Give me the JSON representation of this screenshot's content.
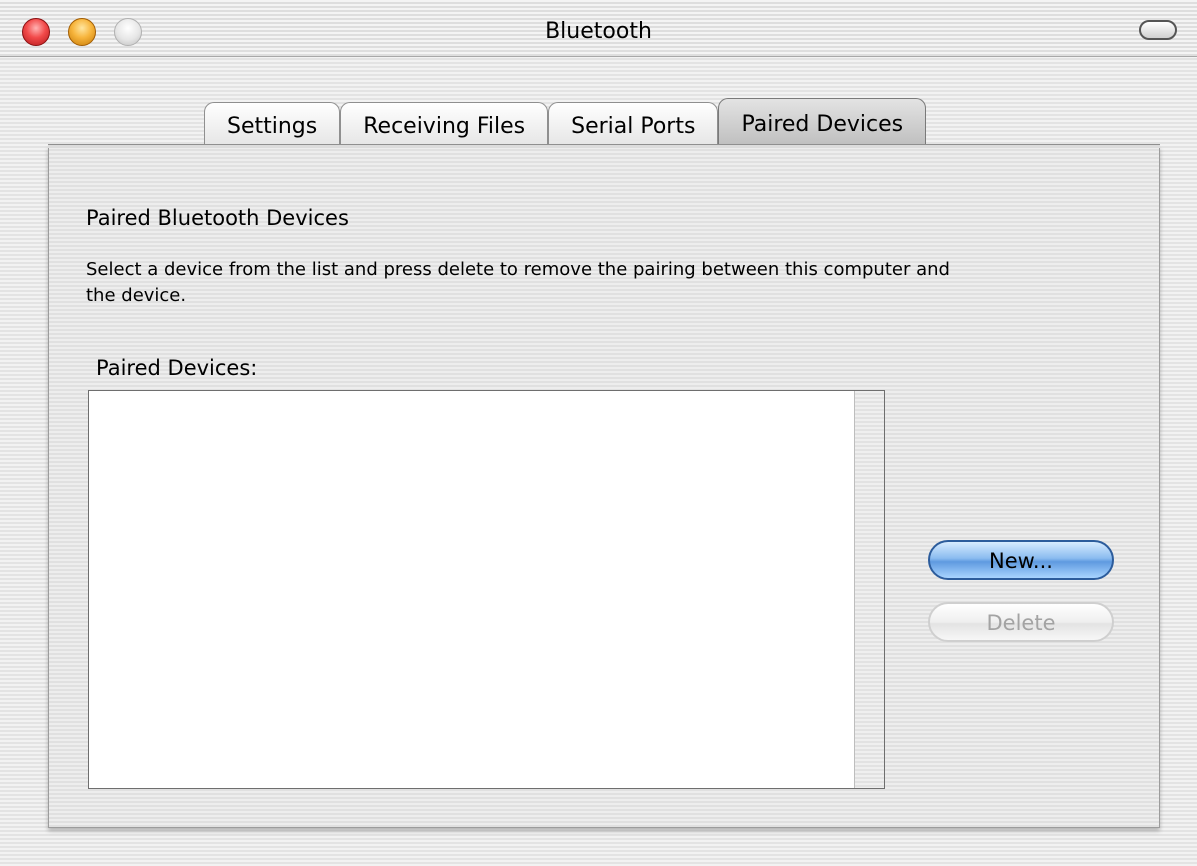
{
  "window": {
    "title": "Bluetooth"
  },
  "tabs": [
    {
      "label": "Settings",
      "selected": false
    },
    {
      "label": "Receiving Files",
      "selected": false
    },
    {
      "label": "Serial Ports",
      "selected": false
    },
    {
      "label": "Paired Devices",
      "selected": true
    }
  ],
  "panel": {
    "section_title": "Paired Bluetooth Devices",
    "description": "Select a device from the list and press delete to remove the pairing between this computer and the device.",
    "list_label": "Paired Devices:",
    "devices": []
  },
  "buttons": {
    "new_label": "New...",
    "delete_label": "Delete",
    "delete_enabled": false
  },
  "colors": {
    "default_button": "#6fa8e8",
    "close_button": "#e84545",
    "minimize_button": "#f5b03a",
    "zoom_button": "#e0e0e0"
  }
}
